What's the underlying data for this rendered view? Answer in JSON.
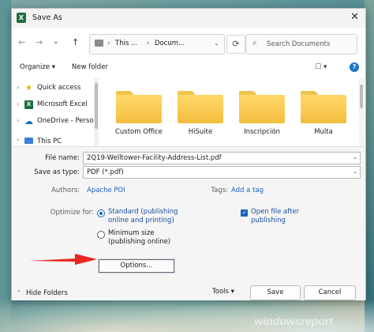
{
  "window": {
    "title": "Save As",
    "app_icon": "excel-icon"
  },
  "nav": {
    "back": "←",
    "forward": "→",
    "dropdown": "⌄",
    "up": "↑"
  },
  "address": {
    "part1": "This ...",
    "separator": "›",
    "part2": "Docum...",
    "dropdown": "⌄"
  },
  "refresh": "⟳",
  "search": {
    "placeholder": "Search Documents"
  },
  "toolbar": {
    "organize": "Organize ▾",
    "new_folder": "New folder",
    "view": "☐ ▾",
    "help": "?"
  },
  "sidebar": {
    "items": [
      {
        "label": "Quick access",
        "icon": "star-icon"
      },
      {
        "label": "Microsoft Excel",
        "icon": "excel-icon"
      },
      {
        "label": "OneDrive - Person",
        "icon": "cloud-icon"
      },
      {
        "label": "This PC",
        "icon": "pc-icon"
      }
    ]
  },
  "folders": [
    "Custom Office",
    "HiSuite",
    "Inscripción",
    "Multa"
  ],
  "form": {
    "file_name_label": "File name:",
    "file_name_value": "2Q19-Welltower-Facility-Address-List.pdf",
    "save_type_label": "Save as type:",
    "save_type_value": "PDF (*.pdf)",
    "authors_label": "Authors:",
    "authors_value": "Apache POI",
    "tags_label": "Tags:",
    "tags_value": "Add a tag",
    "optimize_label": "Optimize for:",
    "standard_line1": "Standard (publishing",
    "standard_line2": "online and printing)",
    "minimum_line1": "Minimum size",
    "minimum_line2": "(publishing online)",
    "open_after_line1": "Open file after",
    "open_after_line2": "publishing",
    "options_button": "Options..."
  },
  "footer": {
    "hide_folders": "Hide Folders",
    "tools": "Tools ▾",
    "save": "Save",
    "cancel": "Cancel"
  },
  "colors": {
    "accent": "#1a63c2",
    "arrow": "#e8271f",
    "folder": "#f3bd3e"
  },
  "watermark": "windowsreport"
}
